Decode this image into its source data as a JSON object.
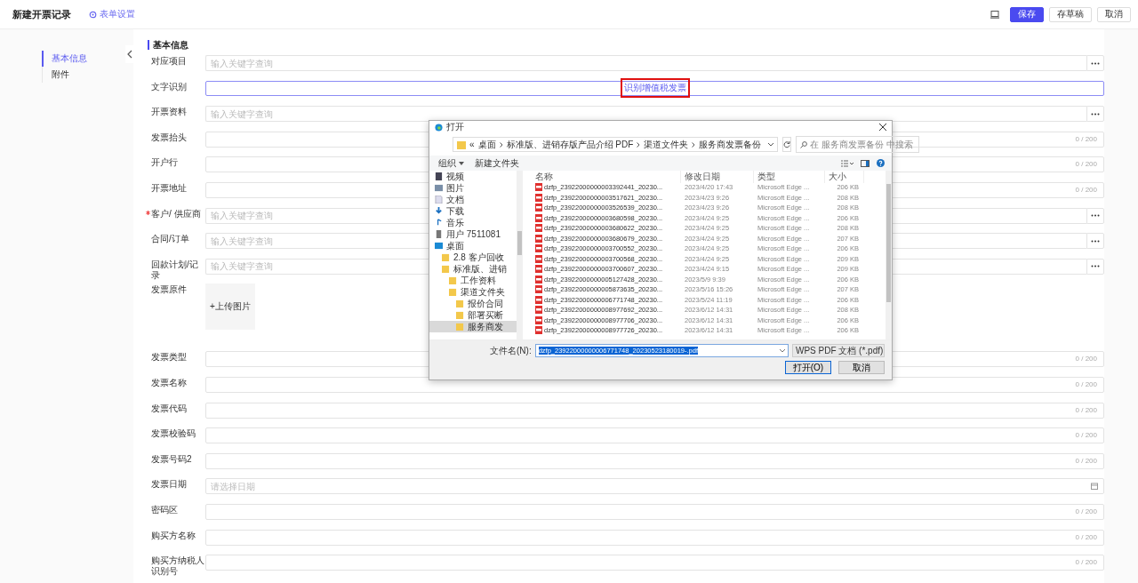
{
  "header": {
    "title": "新建开票记录",
    "settings_link": "表单设置",
    "buttons": [
      {
        "label": "保存",
        "kind": "primary"
      },
      {
        "label": "存草稿",
        "kind": "default"
      },
      {
        "label": "取消",
        "kind": "default"
      }
    ]
  },
  "sidebar": {
    "items": [
      {
        "label": "基本信息",
        "selected": true
      },
      {
        "label": "附件",
        "selected": false
      }
    ]
  },
  "section_title": "基本信息",
  "fields": [
    {
      "label": "对应项目",
      "kind": "lookup",
      "required": false,
      "placeholder": "输入关键字查询"
    },
    {
      "label": "文字识别",
      "kind": "ocr",
      "required": false,
      "button": "识别增值税发票",
      "highlighted": true
    },
    {
      "label": "开票资料",
      "kind": "lookup",
      "required": false,
      "placeholder": "输入关键字查询"
    },
    {
      "label": "发票抬头",
      "kind": "text",
      "required": false,
      "counter": "0 / 200"
    },
    {
      "label": "开户行",
      "kind": "text",
      "required": false,
      "counter": "0 / 200"
    },
    {
      "label": "开票地址",
      "kind": "text",
      "required": false,
      "counter": "0 / 200"
    },
    {
      "label": "客户/ 供应商",
      "kind": "lookup",
      "required": true,
      "placeholder": "输入关键字查询"
    },
    {
      "label": "合同/订单",
      "kind": "lookup",
      "required": false,
      "placeholder": "输入关键字查询"
    },
    {
      "label": "回款计划/记录",
      "kind": "lookup",
      "required": false,
      "placeholder": "输入关键字查询"
    },
    {
      "label": "发票原件",
      "kind": "upload",
      "required": false,
      "button": "+上传图片"
    },
    {
      "label": "发票类型",
      "kind": "text",
      "required": false,
      "counter": "0 / 200"
    },
    {
      "label": "发票名称",
      "kind": "text",
      "required": false,
      "counter": "0 / 200"
    },
    {
      "label": "发票代码",
      "kind": "text",
      "required": false,
      "counter": "0 / 200"
    },
    {
      "label": "发票校验码",
      "kind": "text",
      "required": false,
      "counter": "0 / 200"
    },
    {
      "label": "发票号码2",
      "kind": "text",
      "required": false,
      "counter": "0 / 200"
    },
    {
      "label": "发票日期",
      "kind": "date",
      "required": false,
      "placeholder": "请选择日期"
    },
    {
      "label": "密码区",
      "kind": "text",
      "required": false,
      "counter": "0 / 200"
    },
    {
      "label": "购买方名称",
      "kind": "text",
      "required": false,
      "counter": "0 / 200"
    },
    {
      "label": "购买方纳税人识别号",
      "kind": "text",
      "required": false,
      "counter": "0 / 200"
    }
  ],
  "dialog": {
    "title": "打开",
    "path": [
      "«",
      "桌面",
      "标准版、进销存版产品介绍 PDF",
      "渠道文件夹",
      "服务商发票备份"
    ],
    "search_placeholder": "在 服务商发票备份 中搜索",
    "toolbar": [
      "组织",
      "新建文件夹"
    ],
    "nav": [
      {
        "label": "视频",
        "kind": "video",
        "selected": false
      },
      {
        "label": "图片",
        "kind": "picture",
        "selected": false
      },
      {
        "label": "文档",
        "kind": "document",
        "selected": false
      },
      {
        "label": "下载",
        "kind": "download",
        "selected": false
      },
      {
        "label": "音乐",
        "kind": "music",
        "selected": false
      },
      {
        "label": "用户 7511081",
        "kind": "user",
        "selected": false
      },
      {
        "label": "桌面",
        "kind": "desktop",
        "selected": false,
        "children": [
          {
            "label": "2.8 客户回收",
            "kind": "folder",
            "selected": false
          },
          {
            "label": "标准版、进销",
            "kind": "folder",
            "selected": false,
            "children": [
              {
                "label": "工作资料",
                "kind": "folder",
                "selected": false
              },
              {
                "label": "渠道文件夹",
                "kind": "folder",
                "selected": false,
                "children": [
                  {
                    "label": "报价合同",
                    "kind": "folder",
                    "selected": false
                  },
                  {
                    "label": "部署买断",
                    "kind": "folder",
                    "selected": false
                  },
                  {
                    "label": "服务商发",
                    "kind": "folder",
                    "selected": true
                  }
                ]
              }
            ]
          }
        ]
      }
    ],
    "columns": [
      "名称",
      "修改日期",
      "类型",
      "大小"
    ],
    "files": [
      {
        "name": "dzfp_23922000000003392441_20230...",
        "date": "2023/4/20 17:43",
        "type": "Microsoft Edge ...",
        "size": "206 KB"
      },
      {
        "name": "dzfp_23922000000003517621_20230...",
        "date": "2023/4/23 9:26",
        "type": "Microsoft Edge ...",
        "size": "208 KB"
      },
      {
        "name": "dzfp_23922000000003526539_20230...",
        "date": "2023/4/23 9:26",
        "type": "Microsoft Edge ...",
        "size": "208 KB"
      },
      {
        "name": "dzfp_23922000000003680598_20230...",
        "date": "2023/4/24 9:25",
        "type": "Microsoft Edge ...",
        "size": "206 KB"
      },
      {
        "name": "dzfp_23922000000003680622_20230...",
        "date": "2023/4/24 9:25",
        "type": "Microsoft Edge ...",
        "size": "208 KB"
      },
      {
        "name": "dzfp_23922000000003680679_20230...",
        "date": "2023/4/24 9:25",
        "type": "Microsoft Edge ...",
        "size": "207 KB"
      },
      {
        "name": "dzfp_23922000000003700552_20230...",
        "date": "2023/4/24 9:25",
        "type": "Microsoft Edge ...",
        "size": "206 KB"
      },
      {
        "name": "dzfp_23922000000003700568_20230...",
        "date": "2023/4/24 9:25",
        "type": "Microsoft Edge ...",
        "size": "209 KB"
      },
      {
        "name": "dzfp_23922000000003700607_20230...",
        "date": "2023/4/24 9:15",
        "type": "Microsoft Edge ...",
        "size": "209 KB"
      },
      {
        "name": "dzfp_23922000000005127428_20230...",
        "date": "2023/5/9 9:39",
        "type": "Microsoft Edge ...",
        "size": "206 KB"
      },
      {
        "name": "dzfp_23922000000005873635_20230...",
        "date": "2023/5/16 15:26",
        "type": "Microsoft Edge ...",
        "size": "207 KB"
      },
      {
        "name": "dzfp_23922000000006771748_20230...",
        "date": "2023/5/24 11:19",
        "type": "Microsoft Edge ...",
        "size": "206 KB"
      },
      {
        "name": "dzfp_23922000000008977692_20230...",
        "date": "2023/6/12 14:31",
        "type": "Microsoft Edge ...",
        "size": "208 KB"
      },
      {
        "name": "dzfp_23922000000008977706_20230...",
        "date": "2023/6/12 14:31",
        "type": "Microsoft Edge ...",
        "size": "206 KB"
      },
      {
        "name": "dzfp_23922000000008977726_20230...",
        "date": "2023/6/12 14:31",
        "type": "Microsoft Edge ...",
        "size": "206 KB"
      }
    ],
    "filename_label": "文件名(N):",
    "filename": "dzfp_23922000000006771748_20230523180019-.pdf",
    "filetype": "WPS PDF 文档 (*.pdf)",
    "buttons": [
      {
        "label": "打开(O)",
        "kind": "primary"
      },
      {
        "label": "取消",
        "kind": "default"
      }
    ]
  }
}
